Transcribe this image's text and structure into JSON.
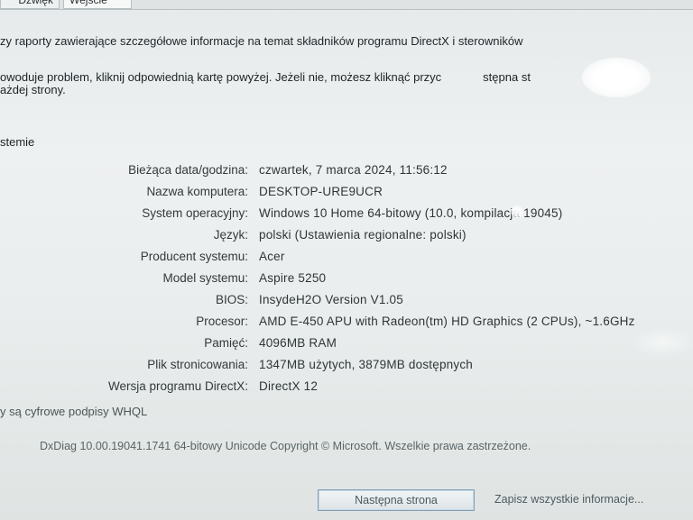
{
  "tabs": [
    {
      "label": "Dźwięk"
    },
    {
      "label": "Wejście"
    }
  ],
  "intro": {
    "line": "zy raporty zawierające szczegółowe informacje na temat składników programu DirectX i sterowników"
  },
  "notice": {
    "line1": "owoduje problem, kliknij odpowiednią kartę powyżej. Jeżeli nie, możesz kliknąć przyc",
    "line1_tail": "stępna st",
    "line2": "ażdej strony."
  },
  "section": {
    "title": "stemie"
  },
  "system_info": [
    {
      "label": "Bieżąca data/godzina:",
      "value": "czwartek, 7 marca 2024, 11:56:12"
    },
    {
      "label": "Nazwa komputera:",
      "value": "DESKTOP-URE9UCR"
    },
    {
      "label": "System operacyjny:",
      "value": "Windows 10 Home 64-bitowy (10.0, kompilacja 19045)"
    },
    {
      "label": "Język:",
      "value": "polski (Ustawienia regionalne: polski)"
    },
    {
      "label": "Producent systemu:",
      "value": "Acer"
    },
    {
      "label": "Model systemu:",
      "value": "Aspire 5250"
    },
    {
      "label": "BIOS:",
      "value": "InsydeH2O Version V1.05"
    },
    {
      "label": "Procesor:",
      "value": "AMD E-450 APU with Radeon(tm) HD Graphics (2 CPUs), ~1.6GHz"
    },
    {
      "label": "Pamięć:",
      "value": "4096MB RAM"
    },
    {
      "label": "Plik stronicowania:",
      "value": "1347MB użytych, 3879MB dostępnych"
    },
    {
      "label": "Wersja programu DirectX:",
      "value": "DirectX 12"
    }
  ],
  "whql": {
    "label": "y są cyfrowe podpisy WHQL"
  },
  "footer": {
    "text": "DxDiag 10.00.19041.1741 64-bitowy Unicode  Copyright © Microsoft. Wszelkie prawa zastrzeżone."
  },
  "buttons": {
    "next_page": "Następna strona",
    "save_all": "Zapisz wszystkie informacje..."
  }
}
